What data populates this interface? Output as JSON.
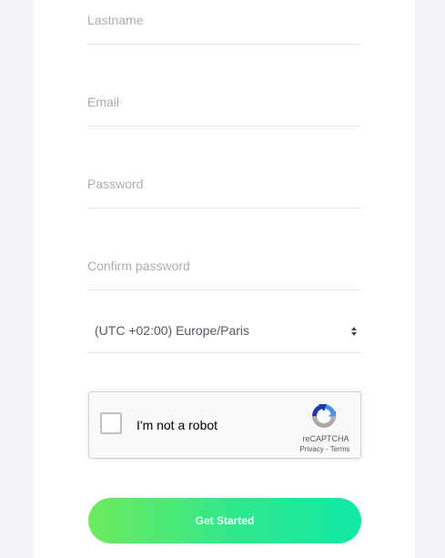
{
  "form": {
    "fields": {
      "lastname": {
        "placeholder": "Lastname",
        "value": ""
      },
      "email": {
        "placeholder": "Email",
        "value": ""
      },
      "password": {
        "placeholder": "Password",
        "value": ""
      },
      "confirm_password": {
        "placeholder": "Confirm password",
        "value": ""
      }
    },
    "timezone": {
      "selected": "(UTC +02:00) Europe/Paris"
    },
    "recaptcha": {
      "label": "I'm not a robot",
      "brand": "reCAPTCHA",
      "privacy": "Privacy",
      "separator": " - ",
      "terms": "Terms"
    },
    "submit_label": "Get Started"
  },
  "colors": {
    "button_gradient_start": "#6eea5d",
    "button_gradient_end": "#10e9a6",
    "recaptcha_blue": "#4a90e2",
    "recaptcha_dark_blue": "#1c3aa9",
    "recaptcha_gray": "#ababab"
  }
}
